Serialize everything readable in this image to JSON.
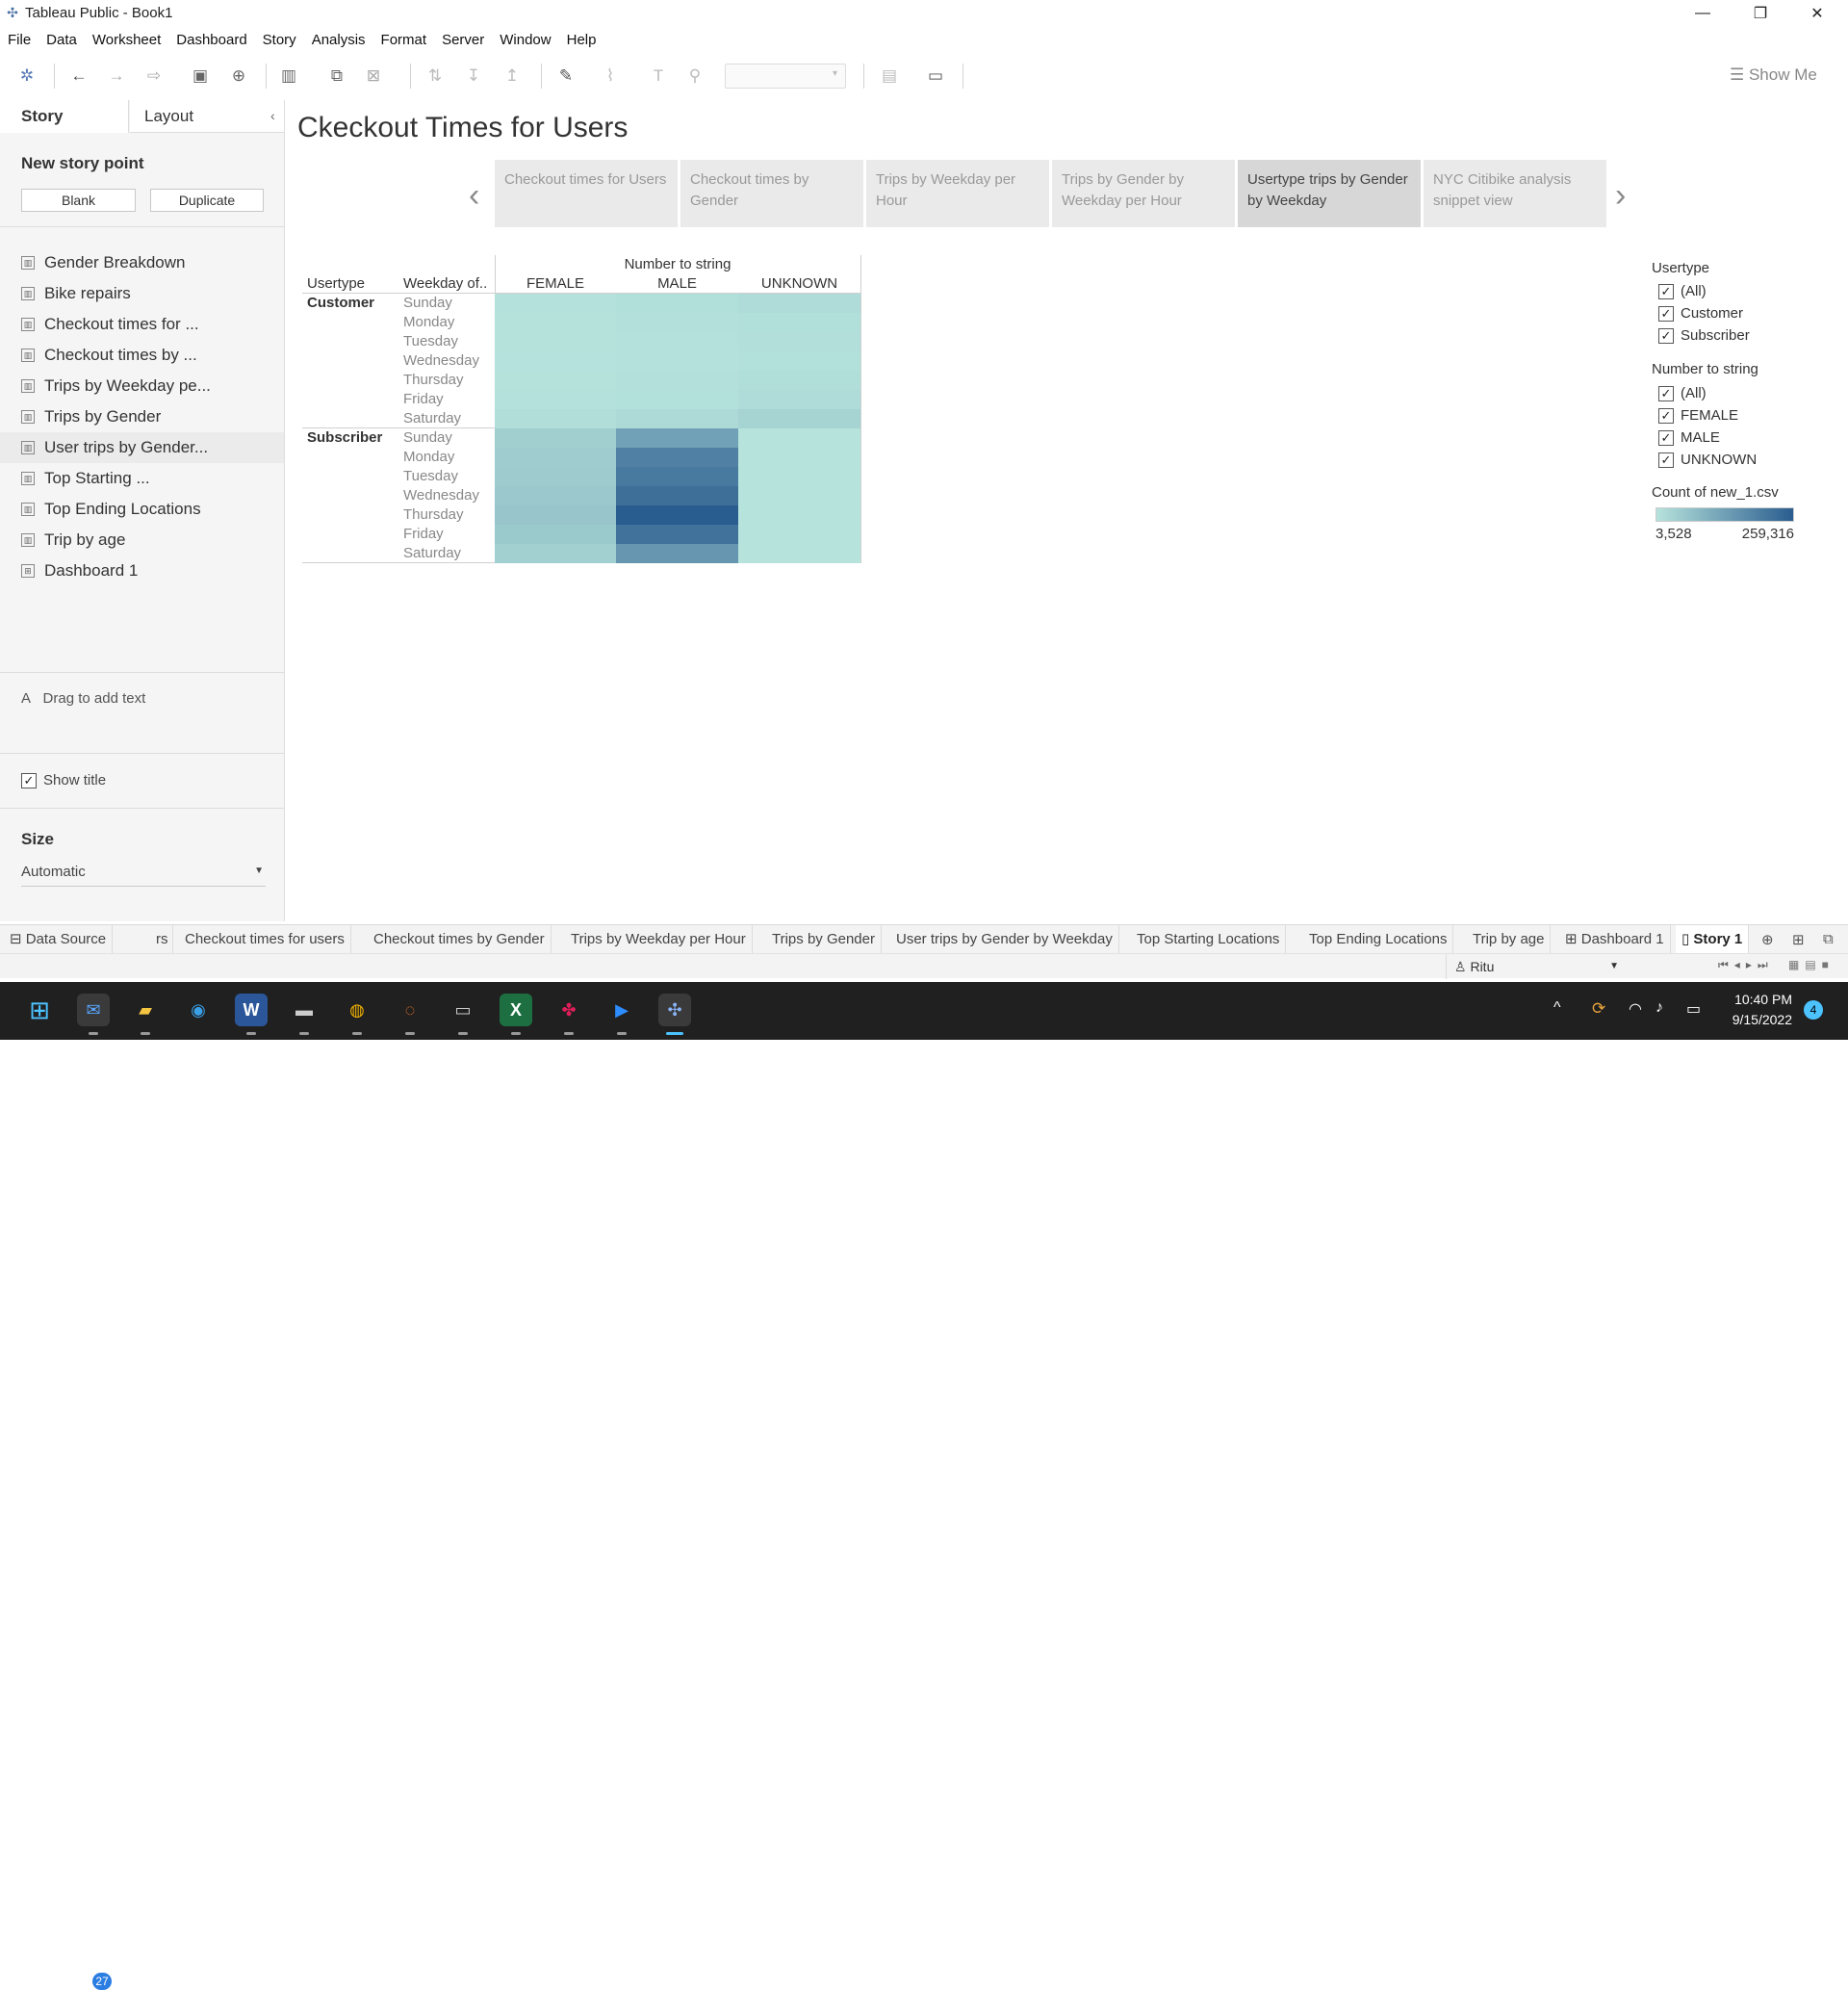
{
  "window": {
    "title": "Tableau Public - Book1"
  },
  "menu": [
    "File",
    "Data",
    "Worksheet",
    "Dashboard",
    "Story",
    "Analysis",
    "Format",
    "Server",
    "Window",
    "Help"
  ],
  "toolbar": {
    "show_me": "Show Me"
  },
  "left_panel": {
    "tab_story": "Story",
    "tab_layout": "Layout",
    "new_story_point": "New story point",
    "blank": "Blank",
    "duplicate": "Duplicate",
    "sheets": [
      "Gender Breakdown",
      "Bike repairs",
      "Checkout times for ...",
      "Checkout times by ...",
      "Trips by Weekday pe...",
      "Trips by Gender",
      "User trips by Gender...",
      "Top Starting ...",
      "Top Ending Locations",
      "Trip by age",
      "Dashboard 1"
    ],
    "drag_text": "Drag to add text",
    "show_title": "Show title",
    "size_label": "Size",
    "size_value": "Automatic"
  },
  "story": {
    "title": "Ckeckout Times for Users",
    "points": [
      "Checkout times for Users",
      "Checkout times by Gender",
      "Trips by Weekday per Hour",
      "Trips by Gender by Weekday per Hour",
      "Usertype trips by Gender by Weekday",
      "NYC Citibike analysis snippet view"
    ],
    "active_point": 4
  },
  "heatmap": {
    "col_header_title": "Number to string",
    "row_header_1": "Usertype",
    "row_header_2": "Weekday of..",
    "columns": [
      "FEMALE",
      "MALE",
      "UNKNOWN"
    ],
    "usertypes": [
      "Customer",
      "Subscriber"
    ],
    "days": [
      "Sunday",
      "Monday",
      "Tuesday",
      "Wednesday",
      "Thursday",
      "Friday",
      "Saturday"
    ],
    "color_scale": {
      "min_color": "#b6e3dc",
      "max_color": "#2a5d8f"
    }
  },
  "chart_data": {
    "type": "heatmap",
    "title": "",
    "x": [
      "FEMALE",
      "MALE",
      "UNKNOWN"
    ],
    "y_groups": [
      "Customer",
      "Subscriber"
    ],
    "y": [
      "Sunday",
      "Monday",
      "Tuesday",
      "Wednesday",
      "Thursday",
      "Friday",
      "Saturday"
    ],
    "values": {
      "Customer": [
        [
          8000,
          12000,
          17000
        ],
        [
          6000,
          9000,
          12000
        ],
        [
          5500,
          8000,
          11000
        ],
        [
          5000,
          7500,
          10000
        ],
        [
          6000,
          9000,
          14000
        ],
        [
          7000,
          10000,
          16000
        ],
        [
          13000,
          20000,
          32000
        ]
      ],
      "Subscriber": [
        [
          42000,
          130000,
          4000
        ],
        [
          48000,
          190000,
          3600
        ],
        [
          50000,
          205000,
          3600
        ],
        [
          55000,
          225000,
          3528
        ],
        [
          60000,
          259316,
          3528
        ],
        [
          52000,
          220000,
          3528
        ],
        [
          40000,
          150000,
          3528
        ]
      ]
    },
    "legend_title": "Count of new_1.csv",
    "range": [
      3528,
      259316
    ]
  },
  "legend": {
    "title": "Count of new_1.csv",
    "min_label": "3,528",
    "max_label": "259,316"
  },
  "filters": {
    "usertype": {
      "title": "Usertype",
      "options": [
        "(All)",
        "Customer",
        "Subscriber"
      ]
    },
    "number_to_string": {
      "title": "Number to string",
      "options": [
        "(All)",
        "FEMALE",
        "MALE",
        "UNKNOWN"
      ]
    }
  },
  "sheet_tabs": {
    "data_source": "Data Source",
    "tabs": [
      "rs",
      "Checkout times for users",
      "Checkout times by Gender",
      "Trips by Weekday per Hour",
      "Trips by Gender",
      "User trips by Gender by Weekday",
      "Top Starting Locations",
      "Top Ending Locations",
      "Trip by age",
      "Dashboard 1",
      "Story 1"
    ]
  },
  "status_bar": {
    "user": "Ritu"
  },
  "taskbar": {
    "mail_badge": "27",
    "clock_time": "10:40 PM",
    "clock_date": "9/15/2022",
    "notification_count": "4"
  }
}
